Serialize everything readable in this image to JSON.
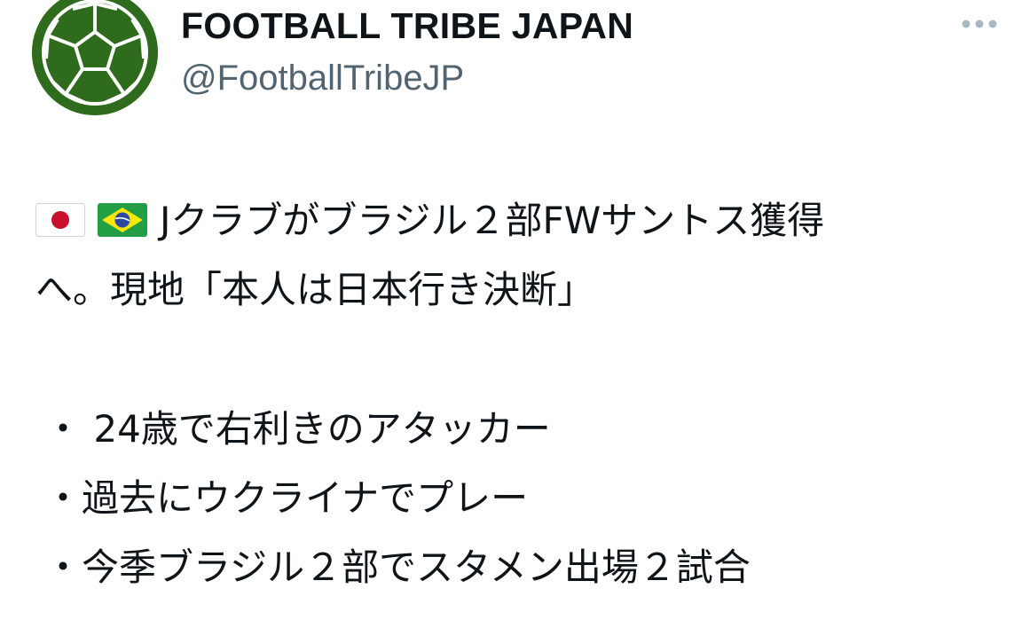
{
  "tweet": {
    "author": {
      "display_name": "FOOTBALL TRIBE JAPAN",
      "handle": "@FootballTribeJP",
      "avatar_icon": "football-icon"
    },
    "more_icon": "more-dots-icon",
    "headline_line1": "Jクラブがブラジル２部FWサントス獲得",
    "headline_line2": "へ。現地「本人は日本行き決断」",
    "flags": [
      "japan-flag-icon",
      "brazil-flag-icon"
    ],
    "bullets": [
      "・ 24歳で右利きのアタッカー",
      "・過去にウクライナでプレー",
      "・今季ブラジル２部でスタメン出場２試合"
    ]
  },
  "colors": {
    "text": "#0f1419",
    "secondary_text": "#536471",
    "avatar_green": "#2e6b1c",
    "more_icon": "#aab8c2"
  }
}
